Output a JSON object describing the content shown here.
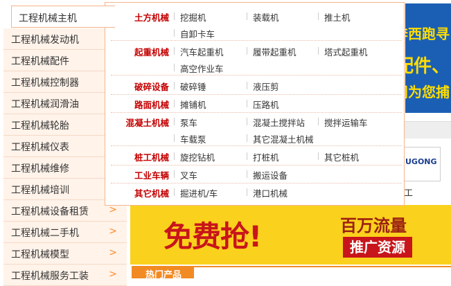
{
  "sidebar": {
    "active": "工程机械主机",
    "items": [
      {
        "label": "工程机械发动机"
      },
      {
        "label": "工程机械配件"
      },
      {
        "label": "工程机械控制器"
      },
      {
        "label": "工程机械润滑油"
      },
      {
        "label": "工程机械轮胎"
      },
      {
        "label": "工程机械仪表"
      },
      {
        "label": "工程机械维修"
      },
      {
        "label": "工程机械培训"
      },
      {
        "label": "工程机械设备租赁"
      },
      {
        "label": "工程机械二手机"
      },
      {
        "label": "工程机械模型"
      },
      {
        "label": "工程机械服务工装"
      }
    ],
    "arrow": ">"
  },
  "flyout": {
    "rows": [
      {
        "cat": "土方机械",
        "links": [
          "挖掘机",
          "装载机",
          "推土机",
          "自卸卡车"
        ]
      },
      {
        "cat": "起重机械",
        "links": [
          "汽车起重机",
          "履带起重机",
          "塔式起重机",
          "高空作业车"
        ]
      },
      {
        "cat": "破碎设备",
        "links": [
          "破碎锤",
          "液压剪"
        ]
      },
      {
        "cat": "路面机械",
        "links": [
          "摊铺机",
          "压路机"
        ]
      },
      {
        "cat": "混凝土机械",
        "links": [
          "泵车",
          "混凝土搅拌站",
          "搅拌运输车",
          "车载泵",
          "其它混凝土机械"
        ]
      },
      {
        "cat": "桩工机械",
        "links": [
          "旋挖钻机",
          "打桩机",
          "其它桩机"
        ]
      },
      {
        "cat": "工业车辆",
        "links": [
          "叉车",
          "搬运设备"
        ]
      },
      {
        "cat": "其它机械",
        "links": [
          "掘进机/车",
          "港口机械"
        ]
      }
    ]
  },
  "banner_top": {
    "line1": "奔西跑寻",
    "line2": "配件、",
    "line3": "间为您捕"
  },
  "brand_logo_text": "UGONG",
  "brand_text_below": "工",
  "ad": {
    "big": "免费抢!",
    "right1": "百万流量",
    "right2": "推广资源"
  },
  "hot_tab": "热门产品",
  "colors": {
    "accent": "#f28a23",
    "category_red": "#c40000",
    "sidebar_bg": "#fff3ea"
  }
}
